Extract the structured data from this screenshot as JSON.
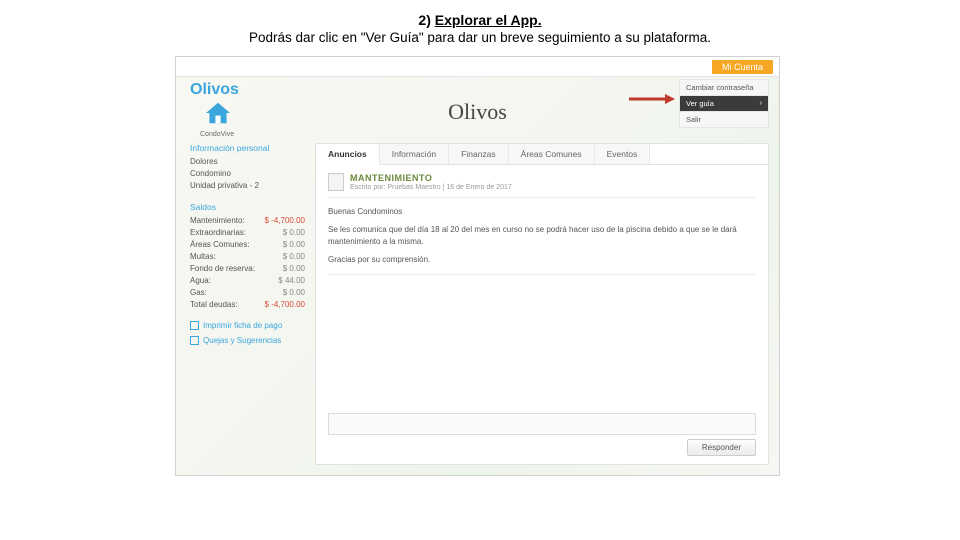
{
  "slide": {
    "number": "2)",
    "title_underlined": "Explorar el App.",
    "desc": "Podrás dar clic en \"Ver Guía\" para dar un breve seguimiento a su plataforma."
  },
  "topbar": {
    "mi_cuenta": "Mi Cuenta"
  },
  "brand": {
    "name": "Olivos",
    "sublabel": "CondoVive"
  },
  "page_title": "Olivos",
  "dropdown": {
    "item0": "Cambiar contraseña",
    "item1": "Ver guía",
    "item2": "Salir"
  },
  "sidebar": {
    "info_head": "Información personal",
    "info": {
      "line0": "Dolores",
      "line1": "Condomino",
      "line2": "Unidad privativa - 2"
    },
    "saldos_head": "Saldos",
    "saldos": [
      {
        "label": "Mantenimiento:",
        "amt": "$ -4,700.00",
        "red": true
      },
      {
        "label": "Extraordinarias:",
        "amt": "$ 0.00"
      },
      {
        "label": "Áreas Comunes:",
        "amt": "$ 0.00"
      },
      {
        "label": "Multas:",
        "amt": "$ 0.00"
      },
      {
        "label": "Fondo de reserva:",
        "amt": "$ 0.00"
      },
      {
        "label": "Agua:",
        "amt": "$ 44.00"
      },
      {
        "label": "Gas:",
        "amt": "$ 0.00"
      },
      {
        "label": "Total deudas:",
        "amt": "$ -4,700.00",
        "red": true
      }
    ],
    "link0": "Imprimir ficha de pago",
    "link1": "Quejas y Sugerencias"
  },
  "tabs": {
    "t0": "Anuncios",
    "t1": "Información",
    "t2": "Finanzas",
    "t3": "Áreas Comunes",
    "t4": "Eventos"
  },
  "post": {
    "title": "MANTENIMIENTO",
    "meta": "Escrito por: Pruebas Maestro | 16 de Enero de 2017",
    "greet": "Buenas Condominos",
    "msg": "Se les comunica que del día 18 al 20 del mes en curso no se podrá hacer uso de la piscina debido a que se le dará mantenimiento a la misma.",
    "thanks": "Gracias por su comprensión.",
    "reply_btn": "Responder"
  }
}
